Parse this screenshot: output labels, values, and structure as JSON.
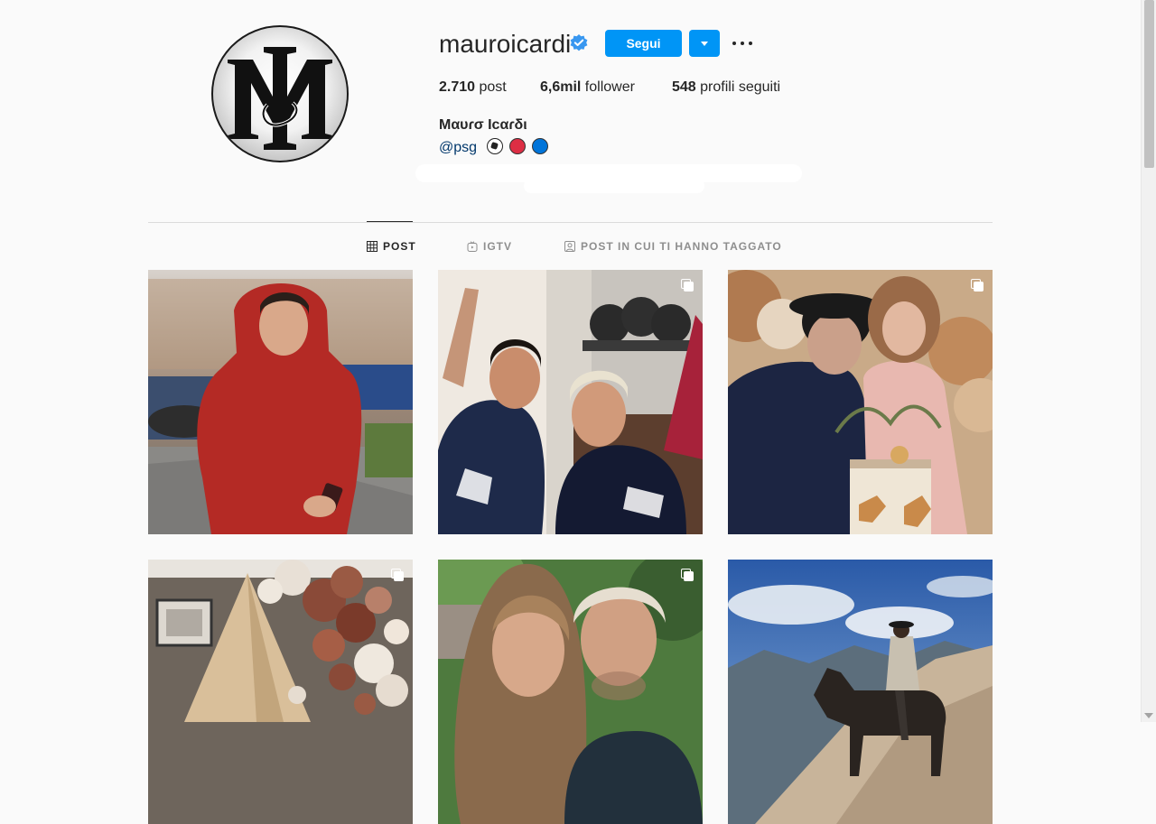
{
  "profile": {
    "username": "mauroicardi",
    "follow_label": "Segui",
    "full_name": "Μαυɾσ Ιcαɾδι",
    "bio_link": "@psg",
    "stats": [
      {
        "value": "2.710",
        "label": " post"
      },
      {
        "value": "6,6mil",
        "label": " follower"
      },
      {
        "value": "548",
        "label": " profili seguiti"
      }
    ]
  },
  "tabs": [
    {
      "label": "POST",
      "icon": "grid-icon",
      "active": true
    },
    {
      "label": "IGTV",
      "icon": "igtv-icon",
      "active": false
    },
    {
      "label": "POST IN CUI TI HANNO TAGGATO",
      "icon": "tagged-icon",
      "active": false
    }
  ],
  "posts": [
    {
      "subject": "man in red hoodie outdoors",
      "multi": false
    },
    {
      "subject": "two players in PSG kit at gym",
      "multi": true
    },
    {
      "subject": "man and girl with birthday cake",
      "multi": true
    },
    {
      "subject": "balloon arch over tent",
      "multi": true
    },
    {
      "subject": "girl and man selfie",
      "multi": true
    },
    {
      "subject": "rider on horse in mountains",
      "multi": false
    }
  ],
  "colors": {
    "accent": "#0095f6",
    "background": "#fafafa",
    "text": "#262626",
    "muted": "#8e8e8e",
    "link": "#00376b"
  }
}
